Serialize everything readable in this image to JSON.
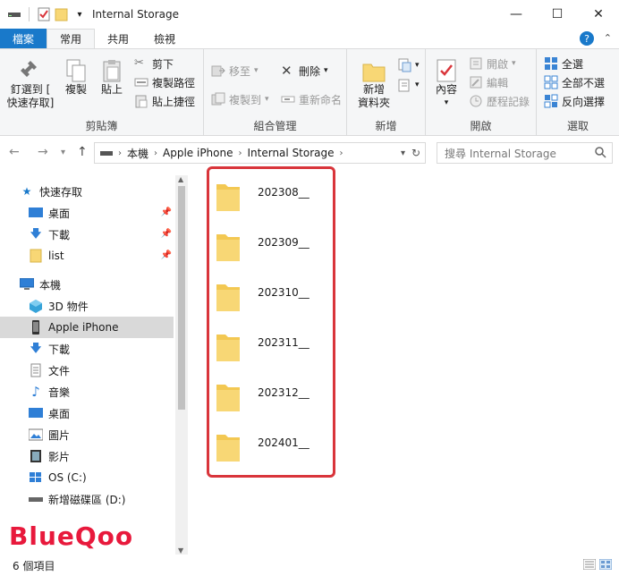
{
  "window": {
    "title": "Internal Storage",
    "minimize": "—",
    "maximize": "☐",
    "close": "✕"
  },
  "ribbon_tabs": [
    {
      "label": "檔案"
    },
    {
      "label": "常用"
    },
    {
      "label": "共用"
    },
    {
      "label": "檢視"
    }
  ],
  "ribbon": {
    "clipboard": {
      "pin_line1": "釘選到 [",
      "pin_line2": "快速存取]",
      "copy": "複製",
      "paste": "貼上",
      "cut": "剪下",
      "copy_path": "複製路徑",
      "paste_shortcut": "貼上捷徑",
      "group": "剪貼簿"
    },
    "organize": {
      "move_to": "移至",
      "copy_to": "複製到",
      "delete": "刪除",
      "rename": "重新命名",
      "group": "組合管理"
    },
    "new": {
      "new_folder_line1": "新增",
      "new_folder_line2": "資料夾",
      "group": "新增"
    },
    "open": {
      "properties": "內容",
      "open": "開啟",
      "edit": "編輯",
      "history": "歷程記錄",
      "group": "開啟"
    },
    "select": {
      "select_all": "全選",
      "select_none": "全部不選",
      "invert": "反向選擇",
      "group": "選取"
    }
  },
  "address": {
    "crumbs": [
      "本機",
      "Apple iPhone",
      "Internal Storage"
    ],
    "search_placeholder": "搜尋 Internal Storage"
  },
  "nav": {
    "quick_access": "快速存取",
    "desktop": "桌面",
    "downloads": "下載",
    "list": "list",
    "this_pc": "本機",
    "objects3d": "3D 物件",
    "iphone": "Apple iPhone",
    "downloads2": "下載",
    "documents": "文件",
    "music": "音樂",
    "desktop2": "桌面",
    "pictures": "圖片",
    "videos": "影片",
    "os_c": "OS (C:)",
    "new_volume_d": "新增磁碟區 (D:)"
  },
  "folders": [
    "202308__",
    "202309__",
    "202310__",
    "202311__",
    "202312__",
    "202401__"
  ],
  "status": {
    "count": "6 個項目"
  },
  "watermark": "BlueQoo",
  "colors": {
    "accent": "#1979ca",
    "highlight": "#d9353b",
    "folder": "#f8d775"
  }
}
